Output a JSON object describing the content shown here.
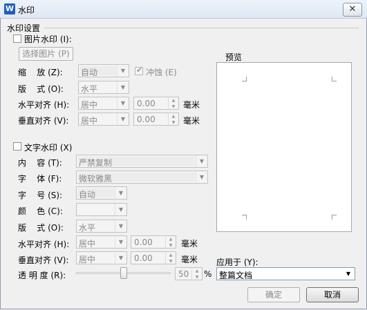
{
  "window": {
    "title": "水印",
    "app_icon": "W",
    "close_glyph": "✕"
  },
  "group": {
    "title": "水印设置"
  },
  "picture_watermark": {
    "checkbox_label": "图片水印 (I):",
    "select_picture_button": "选择图片 (P)",
    "scale_label": "缩    放 (Z):",
    "scale_value": "自动",
    "washout_label": "冲蚀 (E)",
    "washout_checked": true,
    "layout_label": "版    式 (O):",
    "layout_value": "水平",
    "halign_label": "水平对齐 (H):",
    "halign_value": "居中",
    "halign_offset": "0.00",
    "halign_unit": "毫米",
    "valign_label": "垂直对齐 (V):",
    "valign_value": "居中",
    "valign_offset": "0.00",
    "valign_unit": "毫米"
  },
  "text_watermark": {
    "checkbox_label": "文字水印 (X)",
    "content_label": "内    容 (T):",
    "content_value": "严禁复制",
    "font_label": "字    体 (F):",
    "font_value": "微软雅黑",
    "size_label": "字    号 (S):",
    "size_value": "自动",
    "color_label": "颜    色 (C):",
    "layout_label": "版    式 (O):",
    "layout_value": "水平",
    "halign_label": "水平对齐 (H):",
    "halign_value": "居中",
    "halign_offset": "0.00",
    "halign_unit": "毫米",
    "valign_label": "垂直对齐 (V):",
    "valign_value": "居中",
    "valign_offset": "0.00",
    "valign_unit": "毫米",
    "transparency_label": "透 明 度 (R):",
    "transparency_value": "50",
    "transparency_unit": "%"
  },
  "preview": {
    "label": "预览"
  },
  "apply": {
    "label": "应用于 (Y):",
    "value": "整篇文档"
  },
  "buttons": {
    "ok": "确定",
    "cancel": "取消"
  }
}
